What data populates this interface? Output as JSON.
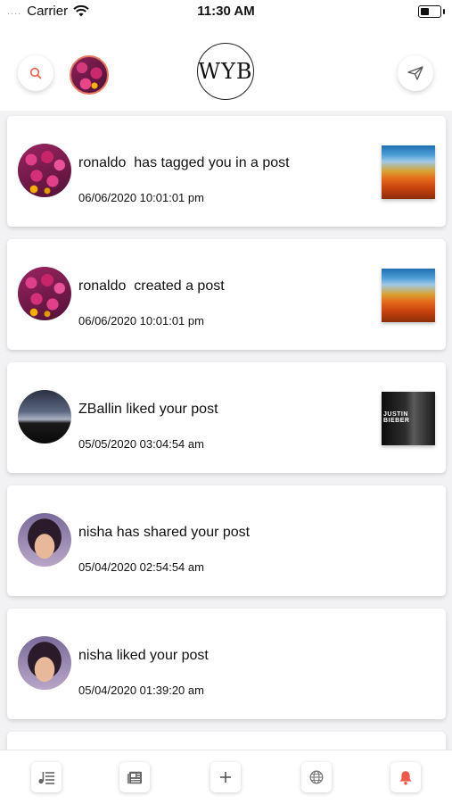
{
  "status_bar": {
    "signal": "....",
    "carrier": "Carrier",
    "time": "11:30 AM"
  },
  "header": {
    "logo_text": "WYB",
    "icons": {
      "search": "search-icon",
      "send": "paper-plane-icon"
    }
  },
  "notifications": [
    {
      "text": "ronaldo  has tagged you in a post",
      "date": "06/06/2020 10:01:01 pm",
      "avatar": "flowers",
      "thumb": "album-orange"
    },
    {
      "text": "ronaldo  created a post",
      "date": "06/06/2020 10:01:01 pm",
      "avatar": "flowers",
      "thumb": "album-orange"
    },
    {
      "text": "ZBallin liked your post",
      "date": "05/05/2020 03:04:54 am",
      "avatar": "sky",
      "thumb": "album-dark",
      "thumb_caption": "JUSTIN BIEBER"
    },
    {
      "text": "nisha has shared your post",
      "date": "05/04/2020 02:54:54 am",
      "avatar": "kid",
      "thumb": null
    },
    {
      "text": "nisha liked your post",
      "date": "05/04/2020 01:39:20 am",
      "avatar": "kid",
      "thumb": null
    }
  ],
  "bottom_nav": [
    {
      "icon": "music-list-icon"
    },
    {
      "icon": "newspaper-icon"
    },
    {
      "icon": "plus-icon"
    },
    {
      "icon": "globe-icon"
    },
    {
      "icon": "bell-icon"
    }
  ],
  "colors": {
    "accent": "#f05a4a",
    "avatar_ring": "#e8765c",
    "background": "#f2f2f4"
  }
}
